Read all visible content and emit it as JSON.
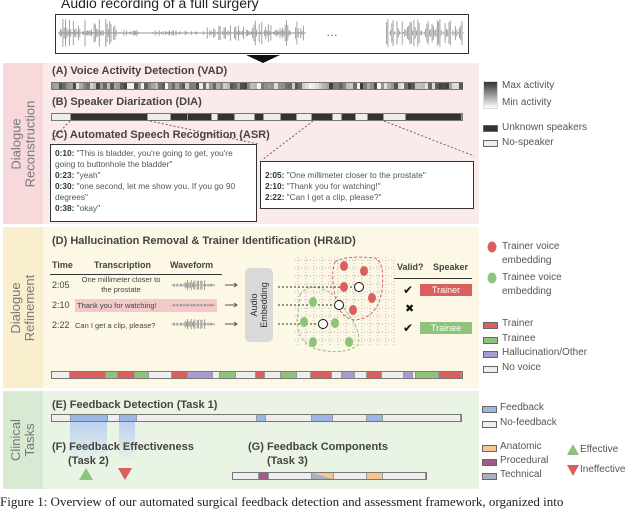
{
  "title": "Audio recording of a full surgery",
  "ellipsis": "…",
  "colors": {
    "trainer": "#d9605f",
    "trainee": "#8dc47a",
    "hallucination": "#a99bd0",
    "no_voice": "#eeeeee",
    "feedback": "#9cb6e6",
    "anatomic": "#f5c691",
    "procedural": "#a35a86",
    "technical": "#a9b0c0",
    "effective": "#8dc47a",
    "ineffective": "#d9605f",
    "pink_panel": "#fbeaea",
    "yellow_panel": "#fdf7e6",
    "green_panel": "#e9f4e4"
  },
  "section1": {
    "side_label": "Dialogue Reconstruction",
    "vad_title": "(A) Voice Activity Detection (VAD)",
    "dia_title": "(B) Speaker Diarization (DIA)",
    "asr_title": "(C) Automated Speech Recognition (ASR)",
    "dia_segments": [
      "none",
      "unknown",
      "none",
      "unknown",
      "unknown",
      "none",
      "unknown",
      "none",
      "unknown",
      "none",
      "unknown",
      "none",
      "unknown",
      "none",
      "unknown",
      "none",
      "unknown",
      "none",
      "unknown"
    ],
    "asr_box1": [
      {
        "time": "0:10:",
        "text": " \"This is bladder, you're going to get, you're going to buttonhole the bladder\""
      },
      {
        "time": "0:23:",
        "text": " \"yeah\""
      },
      {
        "time": "0:30:",
        "text": " \"one second, let me show you. If you go 90 degrees\""
      },
      {
        "time": "0:38:",
        "text": " \"okay\""
      }
    ],
    "asr_box2": [
      {
        "time": "2:05:",
        "text": " \"One millimeter closer to the prostate\""
      },
      {
        "time": "2:10:",
        "text": " \"Thank you for watching!\""
      },
      {
        "time": "2:22:",
        "text": " \"Can I get a clip, please?\""
      }
    ],
    "legend": {
      "max": "Max activity",
      "min": "Min activity",
      "unknown": "Unknown speakers",
      "none": "No-speaker"
    }
  },
  "section2": {
    "side_label": "Dialogue Refinement",
    "title": "(D) Hallucination Removal & Trainer Identification (HR&ID)",
    "headers": {
      "time": "Time",
      "transcription": "Transcription",
      "waveform": "Waveform",
      "valid": "Valid?",
      "speaker": "Speaker"
    },
    "rows": [
      {
        "time": "2:05",
        "text": "One millimeter closer to the prostate",
        "valid": "✔",
        "speaker": "Trainer"
      },
      {
        "time": "2:10",
        "text": "Thank you for watching!",
        "valid": "✖",
        "speaker": ""
      },
      {
        "time": "2:22",
        "text": "Can I get a clip, please?",
        "valid": "✔",
        "speaker": "Trainee"
      }
    ],
    "embedding": "Audio Embedding",
    "legend": {
      "trainer_emb": "Trainer voice embedding",
      "trainee_emb": "Trainee voice embedding",
      "trainer": "Trainer",
      "trainee": "Trainee",
      "halluc": "Hallucination/Other",
      "none": "No voice"
    },
    "segments": [
      "none",
      "trainer",
      "trainee",
      "trainer",
      "trainee",
      "none",
      "trainer",
      "halluc",
      "none",
      "trainee",
      "none",
      "trainer",
      "none",
      "trainee",
      "none",
      "trainer",
      "none",
      "halluc",
      "none",
      "trainer",
      "none",
      "halluc",
      "none",
      "trainee",
      "trainer"
    ]
  },
  "section3": {
    "side_label": "Clinical Tasks",
    "e_title": "(E) Feedback Detection (Task 1)",
    "f_title": "(F) Feedback Effectiveness",
    "f_sub": "(Task 2)",
    "g_title": "(G) Feedback Components",
    "g_sub": "(Task 3)",
    "legend": {
      "feedback": "Feedback",
      "none": "No-feedback",
      "anatomic": "Anatomic",
      "procedural": "Procedural",
      "technical": "Technical",
      "effective": "Effective",
      "ineffective": "Ineffective"
    }
  },
  "caption": "Figure 1: Overview of our automated surgical feedback detection and assessment framework, organized into"
}
